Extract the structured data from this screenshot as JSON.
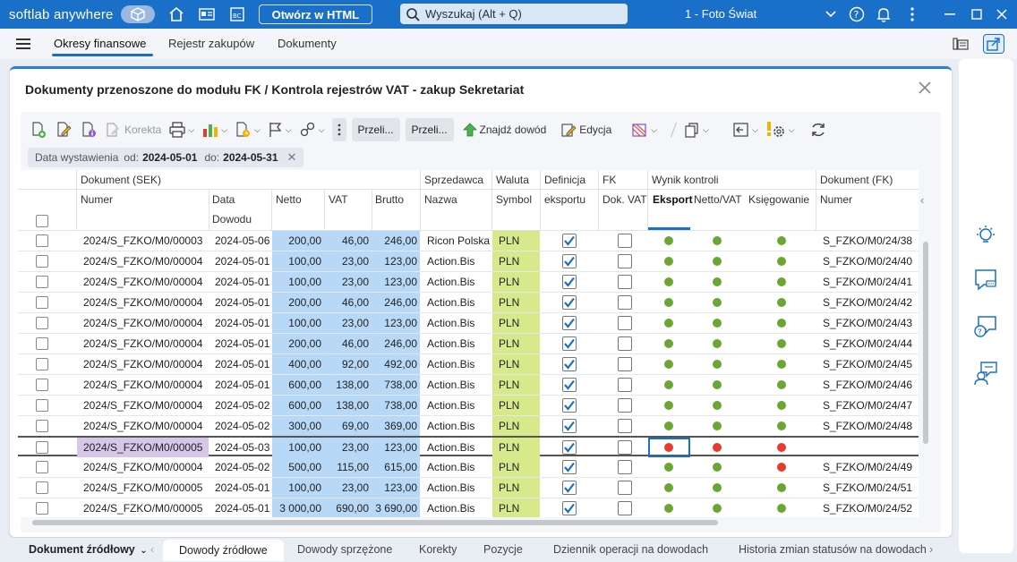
{
  "titlebar": {
    "brand": "softlab anywhere",
    "html_button": "Otwórz w HTML",
    "search_placeholder": "Wyszukaj (Alt + Q)",
    "company": "1 - Foto Świat"
  },
  "menubar": {
    "tabs": [
      "Okresy finansowe",
      "Rejestr zakupów",
      "Dokumenty"
    ],
    "active_tab": 0
  },
  "panel": {
    "title": "Dokumenty przenoszone do modułu FK / Kontrola rejestrów VAT - zakup Sekretariat"
  },
  "toolbar": {
    "korekta": "Korekta",
    "preview1": "Przeli...",
    "preview2": "Przeli...",
    "find": "Znajdź dowód",
    "edit": "Edycja"
  },
  "filter": {
    "label": "Data wystawienia",
    "from_label": "od:",
    "from": "2024-05-01",
    "to_label": "do:",
    "to": "2024-05-31"
  },
  "grid": {
    "groups": {
      "dokument_sek": "Dokument (SEK)",
      "sprzedawca": "Sprzedawca",
      "waluta": "Waluta",
      "definicja": "Definicja",
      "fk": "FK",
      "wynik": "Wynik kontroli",
      "dokument_fk": "Dokument (FK)"
    },
    "columns": {
      "numer": "Numer",
      "data": "Data",
      "dowodu": "Dowodu",
      "netto": "Netto",
      "vat": "VAT",
      "brutto": "Brutto",
      "nazwa": "Nazwa",
      "symbol": "Symbol",
      "eksportu": "eksportu",
      "dokvat": "Dok. VAT",
      "eksport": "Eksport",
      "nettovat": "Netto/VAT",
      "ksiegowanie": "Księgowanie",
      "numer_fk": "Numer"
    },
    "rows": [
      {
        "numer": "2024/S_FZKO/M0/00003",
        "data": "2024-05-06",
        "netto": "200,00",
        "vat": "46,00",
        "brutto": "246,00",
        "nazwa": "Ricon Polska",
        "symbol": "PLN",
        "eksport": "g",
        "nettovat": "g",
        "ksieg": "g",
        "fk": "S_FZKO/M0/24/38"
      },
      {
        "numer": "2024/S_FZKO/M0/00004",
        "data": "2024-05-01",
        "netto": "100,00",
        "vat": "23,00",
        "brutto": "123,00",
        "nazwa": "Action.Bis",
        "symbol": "PLN",
        "eksport": "g",
        "nettovat": "g",
        "ksieg": "g",
        "fk": "S_FZKO/M0/24/40"
      },
      {
        "numer": "2024/S_FZKO/M0/00004",
        "data": "2024-05-01",
        "netto": "100,00",
        "vat": "23,00",
        "brutto": "123,00",
        "nazwa": "Action.Bis",
        "symbol": "PLN",
        "eksport": "g",
        "nettovat": "g",
        "ksieg": "g",
        "fk": "S_FZKO/M0/24/41"
      },
      {
        "numer": "2024/S_FZKO/M0/00004",
        "data": "2024-05-01",
        "netto": "200,00",
        "vat": "46,00",
        "brutto": "246,00",
        "nazwa": "Action.Bis",
        "symbol": "PLN",
        "eksport": "g",
        "nettovat": "g",
        "ksieg": "g",
        "fk": "S_FZKO/M0/24/42"
      },
      {
        "numer": "2024/S_FZKO/M0/00004",
        "data": "2024-05-01",
        "netto": "100,00",
        "vat": "23,00",
        "brutto": "123,00",
        "nazwa": "Action.Bis",
        "symbol": "PLN",
        "eksport": "g",
        "nettovat": "g",
        "ksieg": "g",
        "fk": "S_FZKO/M0/24/43"
      },
      {
        "numer": "2024/S_FZKO/M0/00004",
        "data": "2024-05-01",
        "netto": "200,00",
        "vat": "46,00",
        "brutto": "246,00",
        "nazwa": "Action.Bis",
        "symbol": "PLN",
        "eksport": "g",
        "nettovat": "g",
        "ksieg": "g",
        "fk": "S_FZKO/M0/24/44"
      },
      {
        "numer": "2024/S_FZKO/M0/00004",
        "data": "2024-05-01",
        "netto": "400,00",
        "vat": "92,00",
        "brutto": "492,00",
        "nazwa": "Action.Bis",
        "symbol": "PLN",
        "eksport": "g",
        "nettovat": "g",
        "ksieg": "g",
        "fk": "S_FZKO/M0/24/45"
      },
      {
        "numer": "2024/S_FZKO/M0/00004",
        "data": "2024-05-01",
        "netto": "600,00",
        "vat": "138,00",
        "brutto": "738,00",
        "nazwa": "Action.Bis",
        "symbol": "PLN",
        "eksport": "g",
        "nettovat": "g",
        "ksieg": "g",
        "fk": "S_FZKO/M0/24/46"
      },
      {
        "numer": "2024/S_FZKO/M0/00004",
        "data": "2024-05-02",
        "netto": "600,00",
        "vat": "138,00",
        "brutto": "738,00",
        "nazwa": "Action.Bis",
        "symbol": "PLN",
        "eksport": "g",
        "nettovat": "g",
        "ksieg": "g",
        "fk": "S_FZKO/M0/24/47"
      },
      {
        "numer": "2024/S_FZKO/M0/00004",
        "data": "2024-05-02",
        "netto": "300,00",
        "vat": "69,00",
        "brutto": "369,00",
        "nazwa": "Action.Bis",
        "symbol": "PLN",
        "eksport": "g",
        "nettovat": "g",
        "ksieg": "g",
        "fk": "S_FZKO/M0/24/48"
      },
      {
        "numer": "2024/S_FZKO/M0/00005",
        "data": "2024-05-03",
        "netto": "100,00",
        "vat": "23,00",
        "brutto": "123,00",
        "nazwa": "Action.Bis",
        "symbol": "PLN",
        "eksport": "r",
        "nettovat": "r",
        "ksieg": "r",
        "fk": ""
      },
      {
        "numer": "2024/S_FZKO/M0/00004",
        "data": "2024-05-02",
        "netto": "500,00",
        "vat": "115,00",
        "brutto": "615,00",
        "nazwa": "Action.Bis",
        "symbol": "PLN",
        "eksport": "g",
        "nettovat": "g",
        "ksieg": "r",
        "fk": "S_FZKO/M0/24/49"
      },
      {
        "numer": "2024/S_FZKO/M0/00005",
        "data": "2024-05-01",
        "netto": "100,00",
        "vat": "23,00",
        "brutto": "123,00",
        "nazwa": "Action.Bis",
        "symbol": "PLN",
        "eksport": "g",
        "nettovat": "g",
        "ksieg": "g",
        "fk": "S_FZKO/M0/24/51"
      },
      {
        "numer": "2024/S_FZKO/M0/00005",
        "data": "2024-05-01",
        "netto": "3 000,00",
        "vat": "690,00",
        "brutto": "3 690,00",
        "nazwa": "Action.Bis",
        "symbol": "PLN",
        "eksport": "g",
        "nettovat": "g",
        "ksieg": "g",
        "fk": "S_FZKO/M0/24/52"
      }
    ],
    "selected_row": 10
  },
  "bottom": {
    "label": "Dokument źródłowy",
    "tabs": [
      "Dowody źródłowe",
      "Dowody sprzężone",
      "Korekty",
      "Pozycje",
      "Dziennik operacji na dowodach",
      "Historia zmian statusów na dowodach"
    ],
    "active_tab": 0
  },
  "colors": {
    "accent": "#1a6fc9",
    "amount_bg": "#b7d9f7",
    "currency_bg": "#d7e98a",
    "selected_bg": "#d6c6ea",
    "ok": "#6aa632",
    "error": "#e83a2f"
  }
}
